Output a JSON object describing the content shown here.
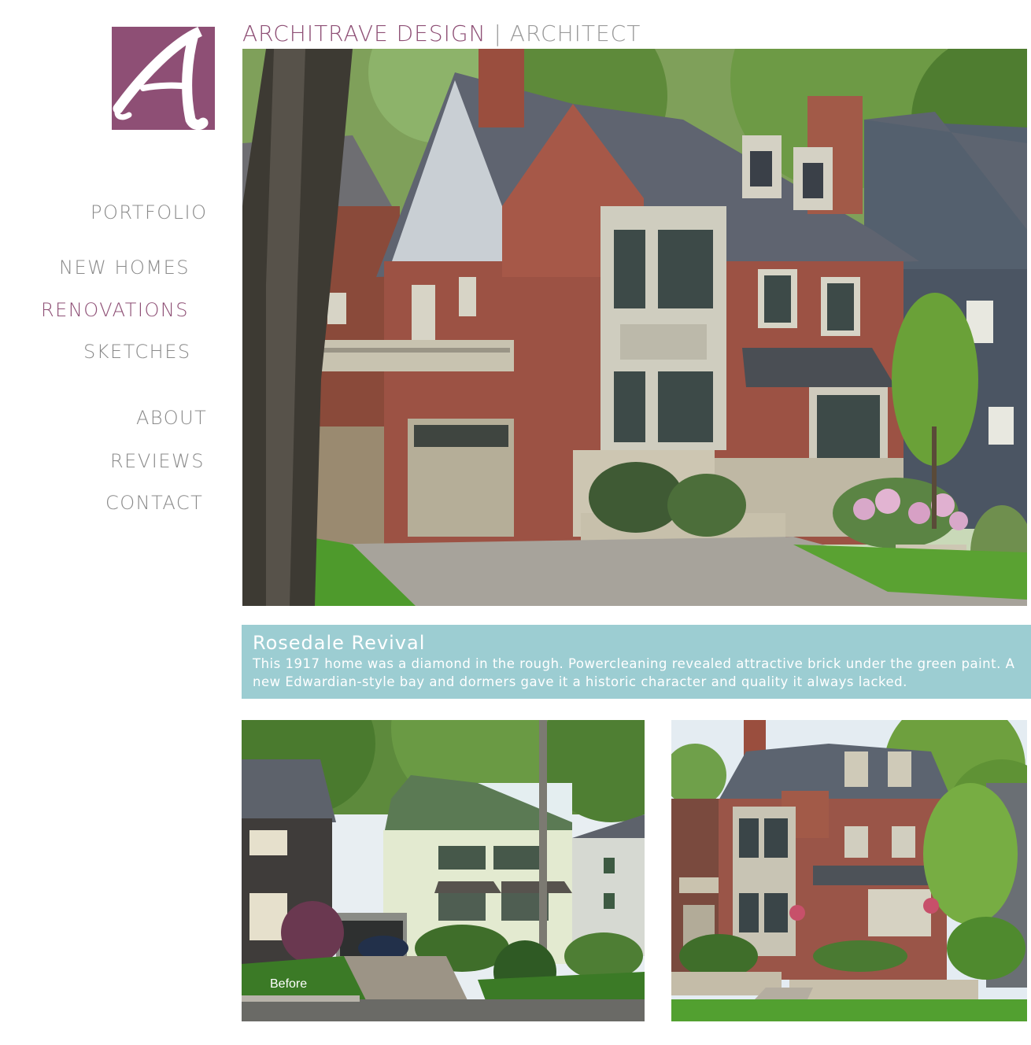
{
  "header": {
    "brand": "ARCHITRAVE DESIGN",
    "separator": "|",
    "role": "ARCHITECT"
  },
  "logo": {
    "letter": "A"
  },
  "nav": {
    "portfolio": "PORTFOLIO",
    "new_homes": "NEW HOMES",
    "renovations": "RENOVATIONS",
    "sketches": "SKETCHES",
    "about": "ABOUT",
    "reviews": "REVIEWS",
    "contact": "CONTACT",
    "active": "renovations"
  },
  "project": {
    "title": "Rosedale Revival",
    "description": "This 1917 home was a diamond in the rough. Powercleaning revealed attractive brick under the green paint. A new Edwardian-style bay and dormers gave it a historic character and quality it always lacked."
  },
  "gallery": {
    "before_label": "Before"
  },
  "colors": {
    "brand": "#8e4f75",
    "nav_text": "#8a8a8a",
    "caption_bg": "#9ccdd2"
  }
}
